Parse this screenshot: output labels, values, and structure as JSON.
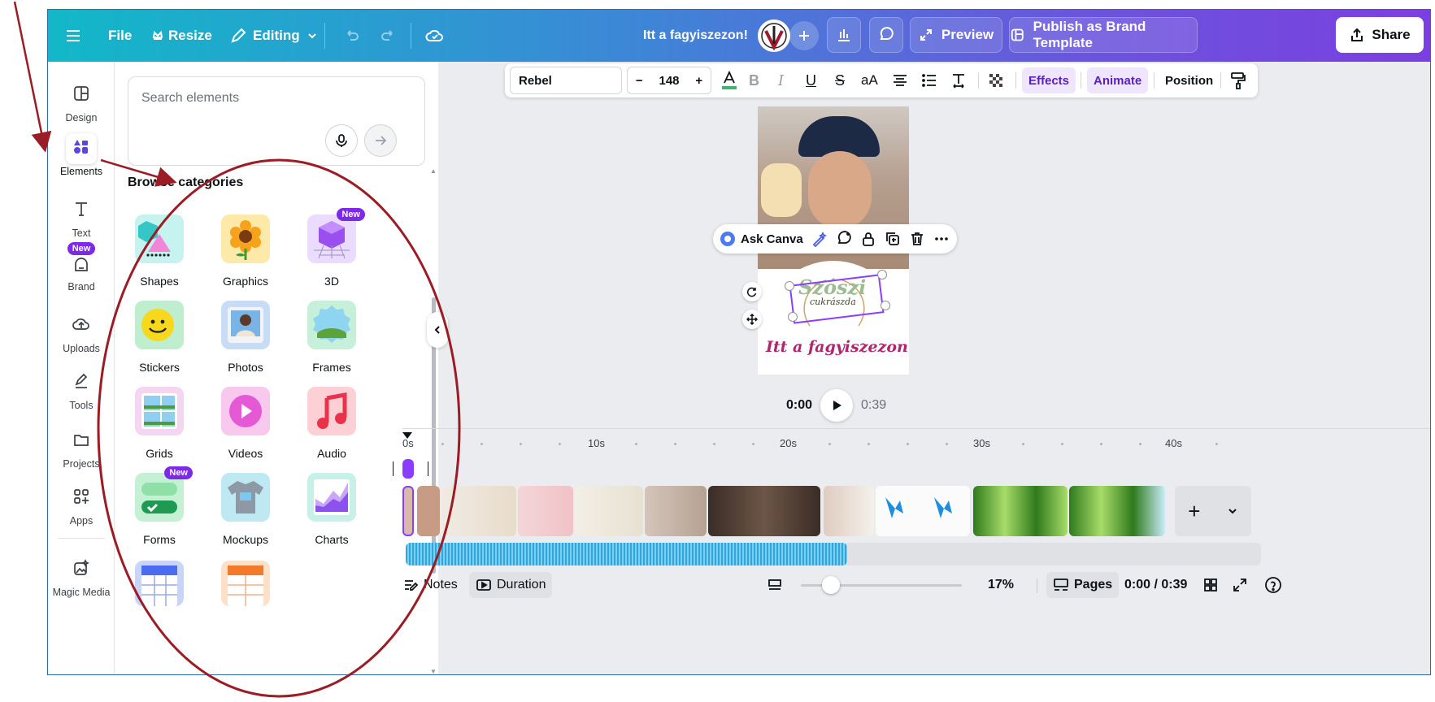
{
  "topbar": {
    "file_label": "File",
    "resize_label": "Resize",
    "editing_label": "Editing",
    "design_title": "Itt a fagyiszezon!",
    "preview_label": "Preview",
    "publish_label": "Publish as Brand Template",
    "share_label": "Share"
  },
  "rail": {
    "items": [
      {
        "label": "Design"
      },
      {
        "label": "Elements"
      },
      {
        "label": "Text"
      },
      {
        "label": "Brand",
        "badge": "New"
      },
      {
        "label": "Uploads"
      },
      {
        "label": "Tools"
      },
      {
        "label": "Projects"
      },
      {
        "label": "Apps"
      },
      {
        "label": "Magic Media"
      }
    ]
  },
  "panel": {
    "search_placeholder": "Search elements",
    "browse_title": "Browse categories",
    "categories": [
      {
        "label": "Shapes"
      },
      {
        "label": "Graphics"
      },
      {
        "label": "3D",
        "badge": "New"
      },
      {
        "label": "Stickers"
      },
      {
        "label": "Photos"
      },
      {
        "label": "Frames"
      },
      {
        "label": "Grids"
      },
      {
        "label": "Videos"
      },
      {
        "label": "Audio"
      },
      {
        "label": "Forms",
        "badge": "New"
      },
      {
        "label": "Mockups"
      },
      {
        "label": "Charts"
      }
    ]
  },
  "text_toolbar": {
    "font": "Rebel",
    "size": "148",
    "minus": "−",
    "plus": "+",
    "case_label": "aA",
    "effects_label": "Effects",
    "animate_label": "Animate",
    "position_label": "Position"
  },
  "canvas": {
    "float_toolbar_label": "Ask Canva",
    "headline": "Itt a fagyiszezon!",
    "logo_main": "Szószi",
    "logo_sub": "cukrászda"
  },
  "playback": {
    "current_time": "0:00",
    "total_time": "0:39"
  },
  "timeline": {
    "ticks": [
      "0s",
      "10s",
      "20s",
      "30s",
      "40s"
    ]
  },
  "bottombar": {
    "notes_label": "Notes",
    "duration_label": "Duration",
    "zoom": "17%",
    "pages_label": "Pages",
    "time_readout": "0:00 / 0:39"
  },
  "colors": {
    "accent": "#8b3dff",
    "annotation": "#9b1c24",
    "headline": "#b0266e"
  }
}
